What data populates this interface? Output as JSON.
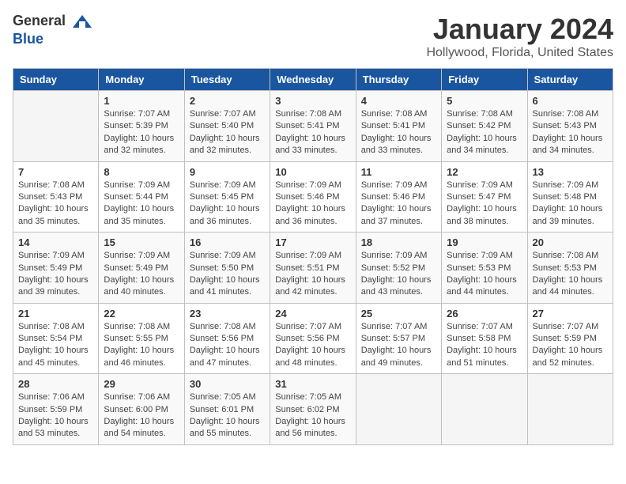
{
  "header": {
    "logo_general": "General",
    "logo_blue": "Blue",
    "title": "January 2024",
    "subtitle": "Hollywood, Florida, United States"
  },
  "days_of_week": [
    "Sunday",
    "Monday",
    "Tuesday",
    "Wednesday",
    "Thursday",
    "Friday",
    "Saturday"
  ],
  "weeks": [
    [
      {
        "day": "",
        "info": ""
      },
      {
        "day": "1",
        "info": "Sunrise: 7:07 AM\nSunset: 5:39 PM\nDaylight: 10 hours\nand 32 minutes."
      },
      {
        "day": "2",
        "info": "Sunrise: 7:07 AM\nSunset: 5:40 PM\nDaylight: 10 hours\nand 32 minutes."
      },
      {
        "day": "3",
        "info": "Sunrise: 7:08 AM\nSunset: 5:41 PM\nDaylight: 10 hours\nand 33 minutes."
      },
      {
        "day": "4",
        "info": "Sunrise: 7:08 AM\nSunset: 5:41 PM\nDaylight: 10 hours\nand 33 minutes."
      },
      {
        "day": "5",
        "info": "Sunrise: 7:08 AM\nSunset: 5:42 PM\nDaylight: 10 hours\nand 34 minutes."
      },
      {
        "day": "6",
        "info": "Sunrise: 7:08 AM\nSunset: 5:43 PM\nDaylight: 10 hours\nand 34 minutes."
      }
    ],
    [
      {
        "day": "7",
        "info": "Sunrise: 7:08 AM\nSunset: 5:43 PM\nDaylight: 10 hours\nand 35 minutes."
      },
      {
        "day": "8",
        "info": "Sunrise: 7:09 AM\nSunset: 5:44 PM\nDaylight: 10 hours\nand 35 minutes."
      },
      {
        "day": "9",
        "info": "Sunrise: 7:09 AM\nSunset: 5:45 PM\nDaylight: 10 hours\nand 36 minutes."
      },
      {
        "day": "10",
        "info": "Sunrise: 7:09 AM\nSunset: 5:46 PM\nDaylight: 10 hours\nand 36 minutes."
      },
      {
        "day": "11",
        "info": "Sunrise: 7:09 AM\nSunset: 5:46 PM\nDaylight: 10 hours\nand 37 minutes."
      },
      {
        "day": "12",
        "info": "Sunrise: 7:09 AM\nSunset: 5:47 PM\nDaylight: 10 hours\nand 38 minutes."
      },
      {
        "day": "13",
        "info": "Sunrise: 7:09 AM\nSunset: 5:48 PM\nDaylight: 10 hours\nand 39 minutes."
      }
    ],
    [
      {
        "day": "14",
        "info": "Sunrise: 7:09 AM\nSunset: 5:49 PM\nDaylight: 10 hours\nand 39 minutes."
      },
      {
        "day": "15",
        "info": "Sunrise: 7:09 AM\nSunset: 5:49 PM\nDaylight: 10 hours\nand 40 minutes."
      },
      {
        "day": "16",
        "info": "Sunrise: 7:09 AM\nSunset: 5:50 PM\nDaylight: 10 hours\nand 41 minutes."
      },
      {
        "day": "17",
        "info": "Sunrise: 7:09 AM\nSunset: 5:51 PM\nDaylight: 10 hours\nand 42 minutes."
      },
      {
        "day": "18",
        "info": "Sunrise: 7:09 AM\nSunset: 5:52 PM\nDaylight: 10 hours\nand 43 minutes."
      },
      {
        "day": "19",
        "info": "Sunrise: 7:09 AM\nSunset: 5:53 PM\nDaylight: 10 hours\nand 44 minutes."
      },
      {
        "day": "20",
        "info": "Sunrise: 7:08 AM\nSunset: 5:53 PM\nDaylight: 10 hours\nand 44 minutes."
      }
    ],
    [
      {
        "day": "21",
        "info": "Sunrise: 7:08 AM\nSunset: 5:54 PM\nDaylight: 10 hours\nand 45 minutes."
      },
      {
        "day": "22",
        "info": "Sunrise: 7:08 AM\nSunset: 5:55 PM\nDaylight: 10 hours\nand 46 minutes."
      },
      {
        "day": "23",
        "info": "Sunrise: 7:08 AM\nSunset: 5:56 PM\nDaylight: 10 hours\nand 47 minutes."
      },
      {
        "day": "24",
        "info": "Sunrise: 7:07 AM\nSunset: 5:56 PM\nDaylight: 10 hours\nand 48 minutes."
      },
      {
        "day": "25",
        "info": "Sunrise: 7:07 AM\nSunset: 5:57 PM\nDaylight: 10 hours\nand 49 minutes."
      },
      {
        "day": "26",
        "info": "Sunrise: 7:07 AM\nSunset: 5:58 PM\nDaylight: 10 hours\nand 51 minutes."
      },
      {
        "day": "27",
        "info": "Sunrise: 7:07 AM\nSunset: 5:59 PM\nDaylight: 10 hours\nand 52 minutes."
      }
    ],
    [
      {
        "day": "28",
        "info": "Sunrise: 7:06 AM\nSunset: 5:59 PM\nDaylight: 10 hours\nand 53 minutes."
      },
      {
        "day": "29",
        "info": "Sunrise: 7:06 AM\nSunset: 6:00 PM\nDaylight: 10 hours\nand 54 minutes."
      },
      {
        "day": "30",
        "info": "Sunrise: 7:05 AM\nSunset: 6:01 PM\nDaylight: 10 hours\nand 55 minutes."
      },
      {
        "day": "31",
        "info": "Sunrise: 7:05 AM\nSunset: 6:02 PM\nDaylight: 10 hours\nand 56 minutes."
      },
      {
        "day": "",
        "info": ""
      },
      {
        "day": "",
        "info": ""
      },
      {
        "day": "",
        "info": ""
      }
    ]
  ]
}
